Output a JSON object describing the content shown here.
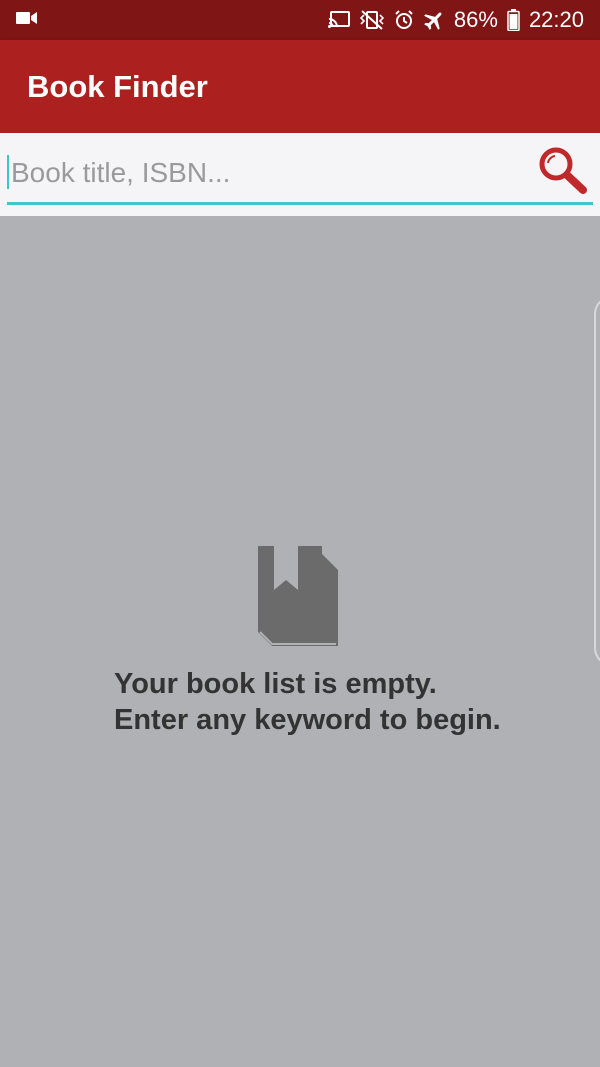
{
  "status_bar": {
    "icons": [
      "video-camera-icon",
      "cast-icon",
      "vibrate-icon",
      "alarm-icon",
      "airplane-mode-icon",
      "battery-icon"
    ],
    "battery_percent": "86%",
    "time": "22:20",
    "background": "#7f1515"
  },
  "app_bar": {
    "title": "Book Finder",
    "background": "#ad2020"
  },
  "search": {
    "value": "",
    "placeholder": "Book title, ISBN...",
    "accent_color": "#3ec6c9",
    "button_icon": "search-icon"
  },
  "empty_state": {
    "icon": "book-icon",
    "line1": "Your book list is empty.",
    "line2": "Enter any keyword to begin."
  }
}
